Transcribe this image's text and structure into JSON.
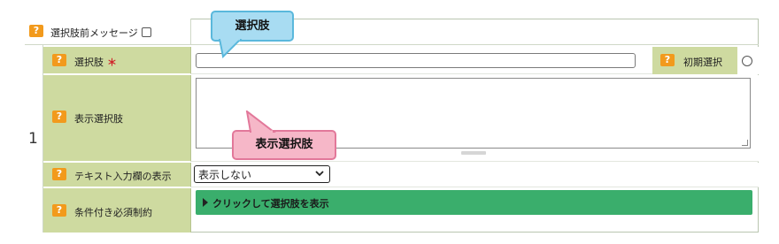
{
  "header": {
    "help_icon": "?",
    "label": "選択肢前メッセージ"
  },
  "row_number": "1",
  "fields": {
    "choice": {
      "help_icon": "?",
      "label": "選択肢",
      "required_mark": "＊",
      "value": ""
    },
    "initial_select": {
      "help_icon": "?",
      "label": "初期選択"
    },
    "display_choice": {
      "help_icon": "?",
      "label": "表示選択肢",
      "value": ""
    },
    "text_input_display": {
      "help_icon": "?",
      "label": "テキスト入力欄の表示",
      "selected": "表示しない"
    },
    "conditional_required": {
      "help_icon": "?",
      "label": "条件付き必須制約",
      "button_label": "クリックして選択肢を表示"
    }
  },
  "callouts": {
    "choice": "選択肢",
    "display_choice": "表示選択肢"
  },
  "colors": {
    "label_bg": "#cedaa0",
    "help_icon": "#f29a1c",
    "accent_green": "#3aae6c",
    "callout_blue": "#a8dcf2",
    "callout_pink": "#f6b7c8"
  }
}
